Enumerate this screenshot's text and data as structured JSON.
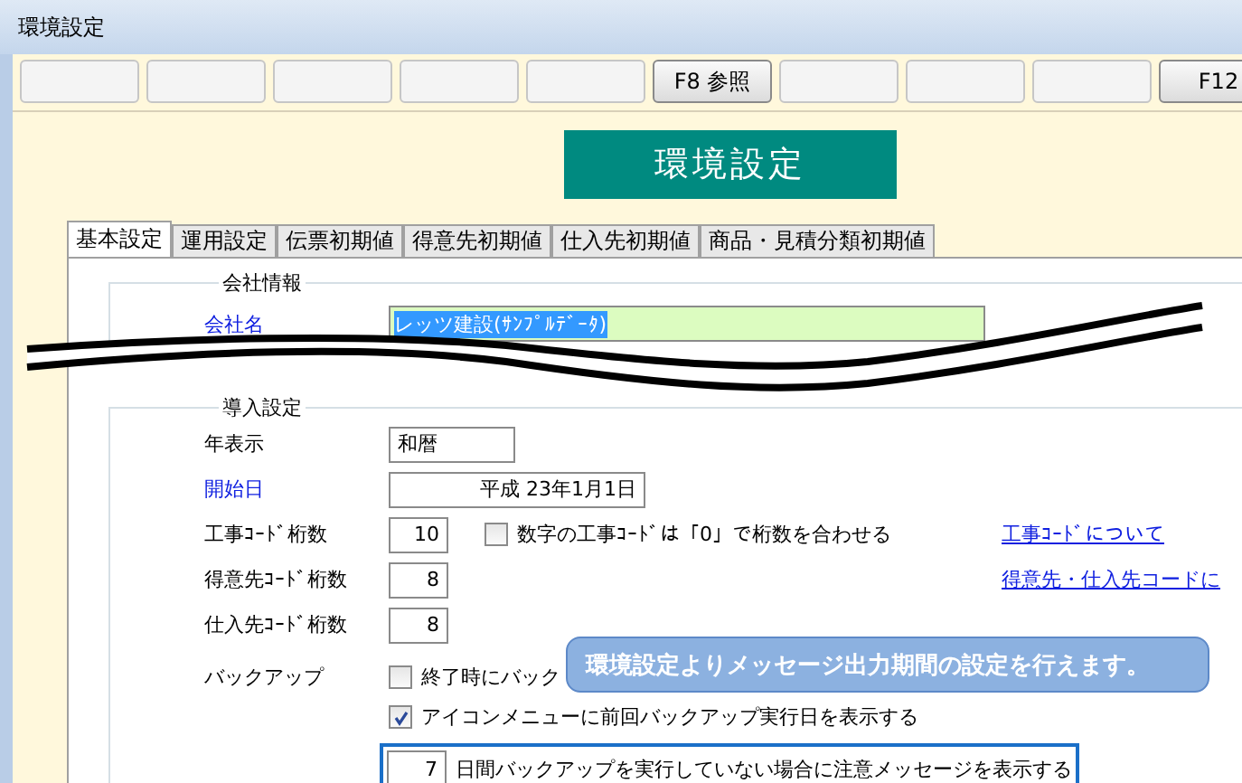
{
  "window": {
    "title": "環境設定"
  },
  "function_keys": [
    {
      "kind": "blank"
    },
    {
      "kind": "blank"
    },
    {
      "kind": "blank"
    },
    {
      "kind": "blank"
    },
    {
      "kind": "blank"
    },
    {
      "kind": "key",
      "label": "F8 参照"
    },
    {
      "kind": "blank"
    },
    {
      "kind": "blank"
    },
    {
      "kind": "blank"
    },
    {
      "kind": "key",
      "label": "F12"
    }
  ],
  "banner": "環境設定",
  "tabs": [
    {
      "label": "基本設定",
      "selected": true
    },
    {
      "label": "運用設定",
      "selected": false
    },
    {
      "label": "伝票初期値",
      "selected": false
    },
    {
      "label": "得意先初期値",
      "selected": false
    },
    {
      "label": "仕入先初期値",
      "selected": false
    },
    {
      "label": "商品・見積分類初期値",
      "selected": false
    }
  ],
  "company_info": {
    "legend": "会社情報",
    "label": "会社名",
    "emphasized": true,
    "value": "レッツ建設(ｻﾝﾌﾟﾙﾃﾞｰﾀ)",
    "selected": true
  },
  "introduction": {
    "legend": "導入設定",
    "rows": [
      {
        "kind": "text",
        "label": "年表示",
        "emphasized": false,
        "value": "和暦"
      },
      {
        "kind": "date",
        "label": "開始日",
        "emphasized": true,
        "value": "平成 23年1月1日"
      },
      {
        "kind": "number",
        "label": "工事ｺｰﾄﾞ桁数",
        "emphasized": false,
        "value": "10",
        "option": {
          "label": "数字の工事ｺｰﾄﾞは「0」で桁数を合わせる",
          "checked": false
        },
        "link": "工事ｺｰﾄﾞについて"
      },
      {
        "kind": "number",
        "label": "得意先ｺｰﾄﾞ桁数",
        "emphasized": false,
        "value": "8",
        "link": "得意先・仕入先コードに"
      },
      {
        "kind": "number",
        "label": "仕入先ｺｰﾄﾞ桁数",
        "emphasized": false,
        "value": "8"
      },
      {
        "kind": "backup",
        "label": "バックアップ",
        "emphasized": false,
        "options": [
          {
            "label": "終了時にバック",
            "checked": false
          },
          {
            "label": "アイコンメニューに前回バックアップ実行日を表示する",
            "checked": true
          }
        ],
        "reminder": {
          "days": "7",
          "text": "日間バックアップを実行していない場合に注意メッセージを表示する",
          "focused": true
        }
      }
    ]
  },
  "tooltip": "環境設定よりメッセージ出力期間の設定を行えます。"
}
